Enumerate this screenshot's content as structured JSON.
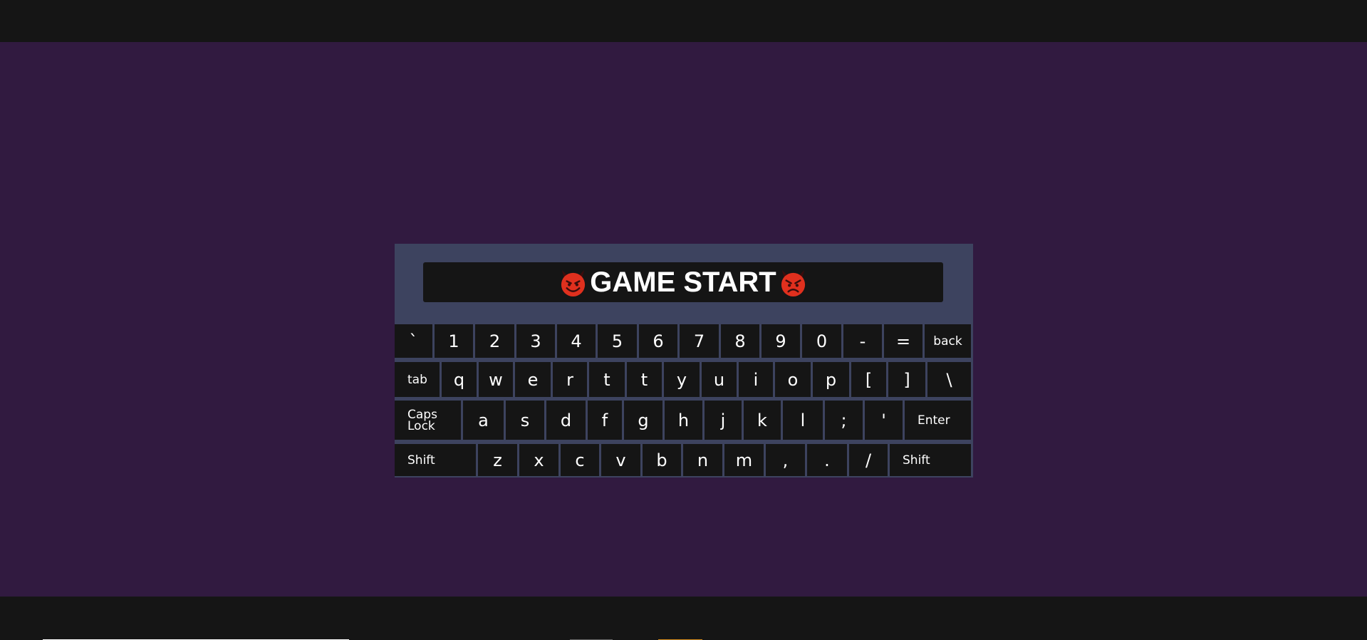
{
  "banner": {
    "title": "GAME START",
    "icons": [
      "smiling-devil-icon",
      "angry-devil-icon"
    ]
  },
  "keyboard": {
    "rows": [
      [
        "`",
        "1",
        "2",
        "3",
        "4",
        "5",
        "6",
        "7",
        "8",
        "9",
        "0",
        "-",
        "=",
        "back"
      ],
      [
        "tab",
        "q",
        "w",
        "e",
        "r",
        "t",
        "t",
        "y",
        "u",
        "i",
        "o",
        "p",
        "[",
        "]",
        "\\"
      ],
      [
        "Caps Lock",
        "a",
        "s",
        "d",
        "f",
        "g",
        "h",
        "j",
        "k",
        "l",
        ";",
        "'",
        "Enter"
      ],
      [
        "Shift",
        "z",
        "x",
        "c",
        "v",
        "b",
        "n",
        "m",
        ",",
        ".",
        "/",
        "Shift"
      ]
    ]
  },
  "colors": {
    "page_background": "#311a40",
    "bars": "#151515",
    "panel": "#3d435f",
    "key": "#151515",
    "key_text": "#ffffff"
  }
}
